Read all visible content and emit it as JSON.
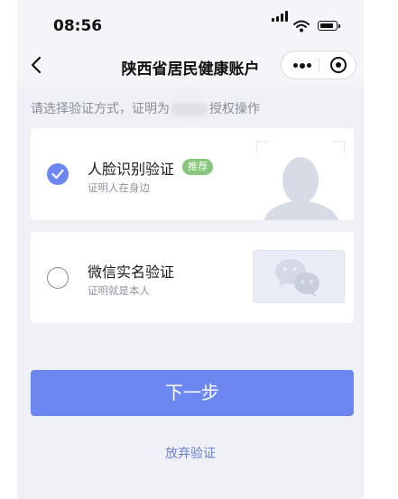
{
  "status_bar": {
    "time": "08:56"
  },
  "nav": {
    "title": "陕西省居民健康账户"
  },
  "prompt": {
    "before": "请选择验证方式，证明为",
    "after": "授权操作"
  },
  "options": [
    {
      "title": "人脸识别验证",
      "badge": "推荐",
      "subtitle": "证明人在身边",
      "selected": true
    },
    {
      "title": "微信实名验证",
      "subtitle": "证明就是本人",
      "selected": false
    }
  ],
  "actions": {
    "next_label": "下一步",
    "abandon_label": "放弃验证"
  },
  "colors": {
    "accent": "#6c87f0",
    "badge": "#87c67a",
    "link": "#6c7fc9"
  }
}
